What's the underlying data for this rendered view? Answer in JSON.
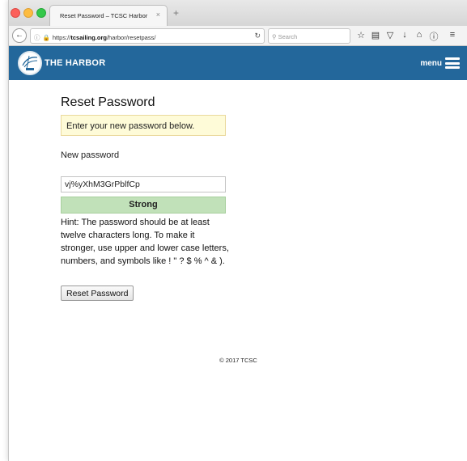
{
  "browser": {
    "tab_title": "Reset Password – TCSC Harbor",
    "tab_close": "×",
    "new_tab": "+",
    "url_prefix": "https://",
    "url_domain": "tcsailing.org",
    "url_path": "/harbor/resetpass/",
    "search_placeholder": "Search",
    "icons": [
      "back-arrow-icon",
      "info-icon",
      "lock-icon",
      "reload-icon",
      "search-icon",
      "star-icon",
      "reading-list-icon",
      "pocket-icon",
      "download-icon",
      "home-icon",
      "settings-icon",
      "hamburger-menu-icon"
    ]
  },
  "site": {
    "title": "THE HARBOR",
    "menu_label": "menu",
    "header_color": "#23679b"
  },
  "main": {
    "page_title": "Reset Password",
    "notice": "Enter your new password below.",
    "new_password_label": "New password",
    "password_value": "vj%yXhM3GrPblfCp",
    "strength": "Strong",
    "hint": "Hint: The password should be at least twelve characters long. To make it stronger, use upper and lower case letters, numbers, and symbols like ! \" ? $ % ^ & ).",
    "submit_label": "Reset Password"
  },
  "footer": {
    "copyright": "© 2017 TCSC"
  }
}
